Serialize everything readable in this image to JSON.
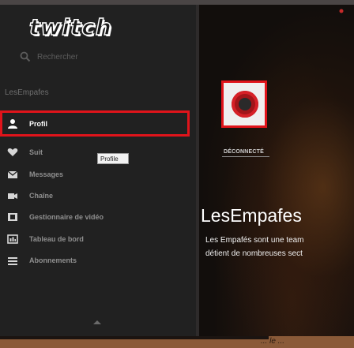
{
  "app": {
    "logo_text": "twitch"
  },
  "search": {
    "placeholder": "Rechercher",
    "icon": "search-icon"
  },
  "sidebar": {
    "section_label": "LesEmpafes",
    "items": [
      {
        "label": "Profil",
        "icon": "person-icon",
        "active": true
      },
      {
        "label": "Suit",
        "icon": "heart-icon"
      },
      {
        "label": "Messages",
        "icon": "mail-icon"
      },
      {
        "label": "Chaîne",
        "icon": "camera-icon"
      },
      {
        "label": "Gestionnaire de vidéo",
        "icon": "film-icon"
      },
      {
        "label": "Tableau de bord",
        "icon": "dashboard-icon"
      },
      {
        "label": "Abonnements",
        "icon": "list-icon"
      }
    ],
    "tooltip": "Profile"
  },
  "channel": {
    "status": "DÉCONNECTÉ",
    "name": "LesEmpafes",
    "description_lines": [
      "Les Empafés sont une team",
      "détient de nombreuses sect"
    ],
    "bottom_text": "... le ... "
  },
  "colors": {
    "accent_red": "#e0141b",
    "sidebar_bg": "#212121"
  }
}
